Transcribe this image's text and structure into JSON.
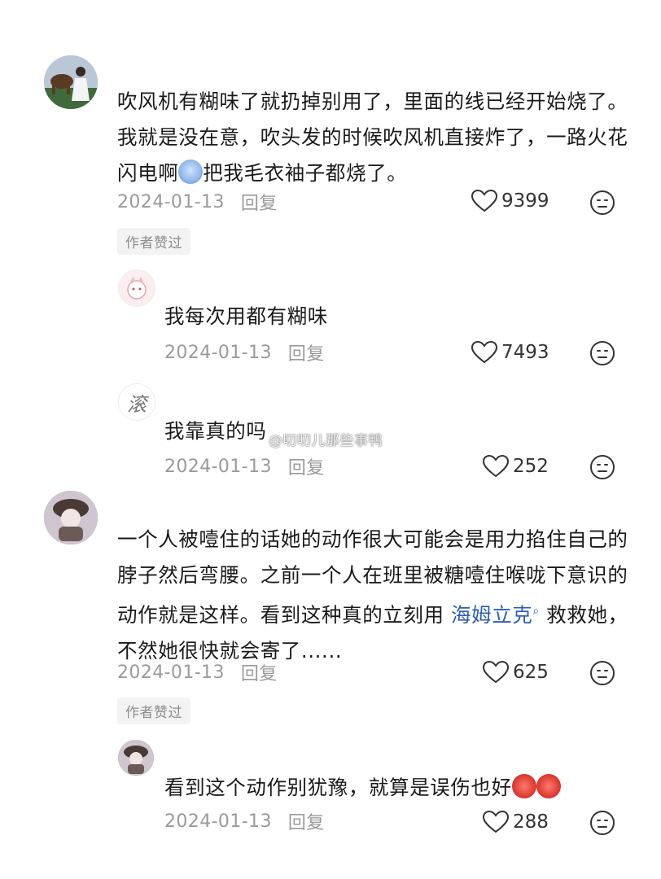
{
  "comments": [
    {
      "text_parts": [
        "吹风机有糊味了就扔掉别用了，里面的线已经开始烧了。我就是没在意，吹头发的时候吹风机直接炸了，一路火花闪电啊",
        "把我毛衣袖子都烧了。"
      ],
      "emoji": "scared-face-emoji",
      "date": "2024-01-13",
      "reply_label": "回复",
      "likes": "9399",
      "badge": "作者赞过"
    },
    {
      "text": "我每次用都有糊味",
      "date": "2024-01-13",
      "reply_label": "回复",
      "likes": "7493"
    },
    {
      "text": "我靠真的吗",
      "date": "2024-01-13",
      "reply_label": "回复",
      "likes": "252"
    },
    {
      "text_before_link": "一个人被噎住的话她的动作很大可能会是用力掐住自己的脖子然后弯腰。之前一个人在班里被糖噎住喉咙下意识的动作就是这样。看到这种真的立刻用 ",
      "link": "海姆立克",
      "text_after_link": " 救救她，不然她很快就会寄了......",
      "date": "2024-01-13",
      "reply_label": "回复",
      "likes": "625",
      "badge": "作者赞过"
    },
    {
      "text": "看到这个动作别犹豫，就算是误伤也好",
      "emoji": "angry-devil-emoji",
      "date": "2024-01-13",
      "reply_label": "回复",
      "likes": "288"
    }
  ],
  "avatar3_text": "滚",
  "watermark": "@叨叨儿那些事鸭",
  "colors": {
    "link": "#2b5db5",
    "meta": "#9a9a9a",
    "badge_bg": "#f3f3f3"
  }
}
